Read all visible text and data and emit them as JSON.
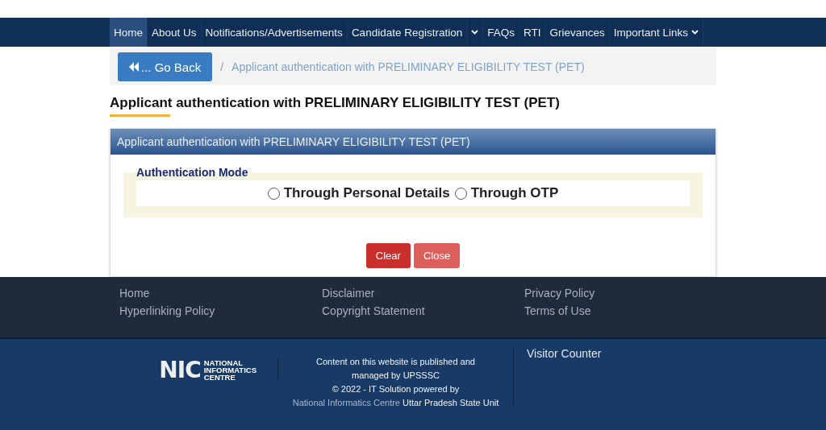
{
  "nav": {
    "items": [
      {
        "label": "Home",
        "selected": true,
        "kind": "link"
      },
      {
        "label": "About Us",
        "selected": false,
        "kind": "link"
      },
      {
        "label": "Notifications/Advertisements",
        "selected": false,
        "kind": "link"
      },
      {
        "label": "Candidate Registration",
        "selected": false,
        "kind": "split"
      },
      {
        "label": "FAQs",
        "selected": false,
        "kind": "link"
      },
      {
        "label": "RTI",
        "selected": false,
        "kind": "link"
      },
      {
        "label": "Grievances",
        "selected": false,
        "kind": "link"
      },
      {
        "label": "Important Links",
        "selected": false,
        "kind": "dropdown"
      }
    ]
  },
  "breadcrumb": {
    "back_button": "... Go Back",
    "separator": "/",
    "current": "Applicant authentication with PRELIMINARY ELIGIBILITY TEST (PET)"
  },
  "page_title": "Applicant authentication with PRELIMINARY ELIGIBILITY TEST (PET)",
  "panel": {
    "title": "Applicant authentication with PRELIMINARY ELIGIBILITY TEST (PET)",
    "fieldset": {
      "legend": "Authentication Mode",
      "options": [
        {
          "label": "Through Personal Details",
          "selected": false
        },
        {
          "label": "Through OTP",
          "selected": false
        }
      ]
    },
    "buttons": [
      {
        "label": "Clear",
        "kind": "danger"
      },
      {
        "label": "Close",
        "kind": "light-danger"
      }
    ]
  },
  "footer": {
    "links": [
      "Home",
      "Disclaimer",
      "Privacy Policy",
      "Hyperlinking Policy",
      "Copyright Statement",
      "Terms of Use"
    ],
    "logo": {
      "mark": "NIC",
      "name": [
        "NATIONAL",
        "INFORMATICS",
        "CENTRE"
      ]
    },
    "notice": "Content on this website is published and managed by UPSSSC",
    "credit": {
      "before": "© 2022 - IT Solution powered by",
      "link": "National Informatics Centre",
      "after": "Uttar Pradesh State Unit"
    },
    "visitor_counter": "Visitor Counter"
  }
}
